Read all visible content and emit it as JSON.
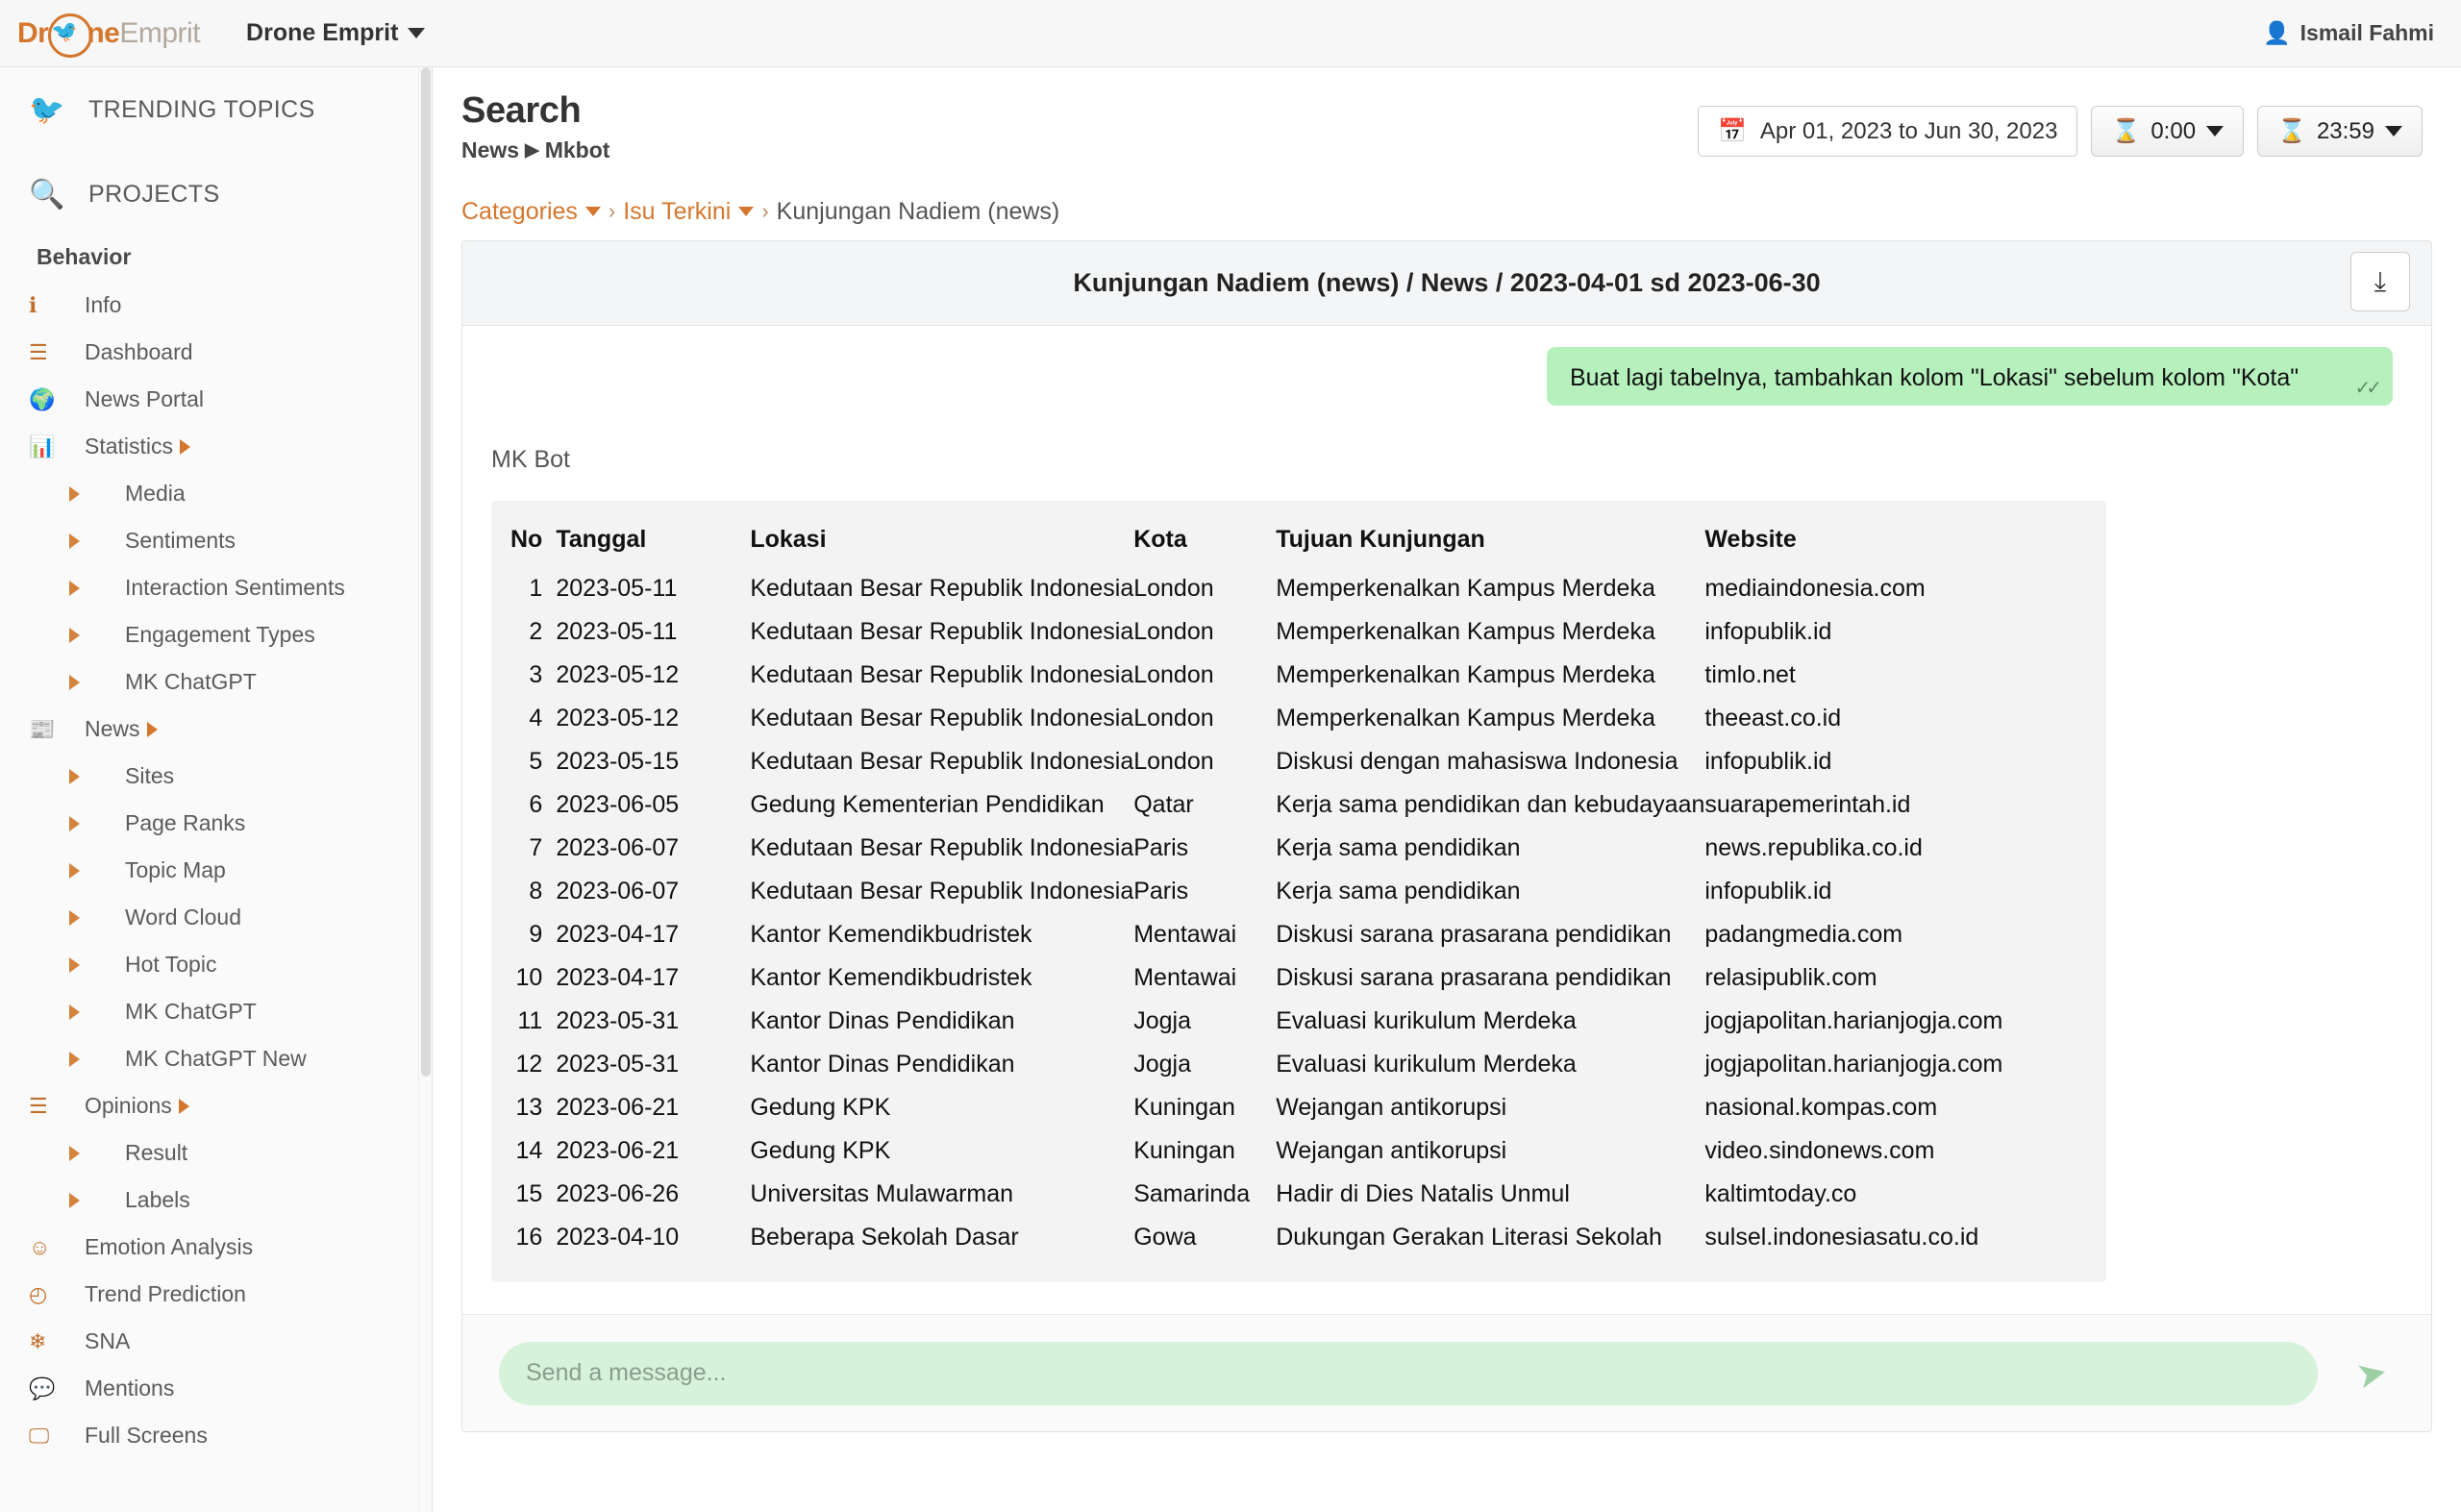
{
  "topbar": {
    "logo_dr": "Dr",
    "logo_ne": "ne",
    "logo_emprit": "Emprit",
    "bird_icon": "bird-icon",
    "app_switcher": "Drone Emprit",
    "user_name": "Ismail Fahmi",
    "user_icon": "user-icon"
  },
  "sidebar": {
    "top_items": [
      {
        "label": "TRENDING TOPICS",
        "icon": "twitter-bird-icon"
      },
      {
        "label": "PROJECTS",
        "icon": "search-icon"
      }
    ],
    "section_label": "Behavior",
    "items": [
      {
        "label": "Info",
        "icon": "info-circle-icon",
        "level": 1,
        "arrow": false
      },
      {
        "label": "Dashboard",
        "icon": "list-icon",
        "level": 1,
        "arrow": false
      },
      {
        "label": "News Portal",
        "icon": "globe-icon",
        "level": 1,
        "arrow": false
      },
      {
        "label": "Statistics",
        "icon": "bar-chart-icon",
        "level": 1,
        "arrow": true
      },
      {
        "label": "Media",
        "icon": "triangle-right-icon",
        "level": 2,
        "arrow": false
      },
      {
        "label": "Sentiments",
        "icon": "triangle-right-icon",
        "level": 2,
        "arrow": false
      },
      {
        "label": "Interaction Sentiments",
        "icon": "triangle-right-icon",
        "level": 2,
        "arrow": false
      },
      {
        "label": "Engagement Types",
        "icon": "triangle-right-icon",
        "level": 2,
        "arrow": false
      },
      {
        "label": "MK ChatGPT",
        "icon": "triangle-right-icon",
        "level": 2,
        "arrow": false
      },
      {
        "label": "News",
        "icon": "newspaper-icon",
        "level": 1,
        "arrow": true
      },
      {
        "label": "Sites",
        "icon": "triangle-right-icon",
        "level": 2,
        "arrow": false
      },
      {
        "label": "Page Ranks",
        "icon": "triangle-right-icon",
        "level": 2,
        "arrow": false
      },
      {
        "label": "Topic Map",
        "icon": "triangle-right-icon",
        "level": 2,
        "arrow": false
      },
      {
        "label": "Word Cloud",
        "icon": "triangle-right-icon",
        "level": 2,
        "arrow": false
      },
      {
        "label": "Hot Topic",
        "icon": "triangle-right-icon",
        "level": 2,
        "arrow": false
      },
      {
        "label": "MK ChatGPT",
        "icon": "triangle-right-icon",
        "level": 2,
        "arrow": false
      },
      {
        "label": "MK ChatGPT New",
        "icon": "triangle-right-icon",
        "level": 2,
        "arrow": false
      },
      {
        "label": "Opinions",
        "icon": "stack-icon",
        "level": 1,
        "arrow": true
      },
      {
        "label": "Result",
        "icon": "triangle-right-icon",
        "level": 2,
        "arrow": false
      },
      {
        "label": "Labels",
        "icon": "triangle-right-icon",
        "level": 2,
        "arrow": false
      },
      {
        "label": "Emotion Analysis",
        "icon": "smiley-icon",
        "level": 1,
        "arrow": false
      },
      {
        "label": "Trend Prediction",
        "icon": "clock-icon",
        "level": 1,
        "arrow": false
      },
      {
        "label": "SNA",
        "icon": "snowflake-icon",
        "level": 1,
        "arrow": false
      },
      {
        "label": "Mentions",
        "icon": "chat-bubble-icon",
        "level": 1,
        "arrow": false
      },
      {
        "label": "Full Screens",
        "icon": "monitor-icon",
        "level": 1,
        "arrow": false
      }
    ]
  },
  "header": {
    "title": "Search",
    "breadcrumb_parent": "News",
    "breadcrumb_child": "Mkbot",
    "date_range": "Apr 01, 2023 to Jun 30, 2023",
    "calendar_icon": "calendar-icon",
    "time_start": "0:00",
    "time_end": "23:59",
    "hourglass_icon": "hourglass-icon"
  },
  "crumbs": {
    "categories": "Categories",
    "isu_terkini": "Isu Terkini",
    "current": "Kunjungan Nadiem (news)"
  },
  "chat": {
    "panel_title": "Kunjungan Nadiem (news) / News / 2023-04-01 sd 2023-06-30",
    "download_icon": "download-icon",
    "user_message": "Buat lagi tabelnya, tambahkan kolom \"Lokasi\" sebelum kolom \"Kota\"",
    "read_ticks": "✓✓",
    "bot_name": "MK Bot",
    "input_placeholder": "Send a message...",
    "input_value": "",
    "send_icon": "send-paper-plane-icon"
  },
  "table": {
    "headers": [
      "No",
      "Tanggal",
      "Lokasi",
      "Kota",
      "Tujuan Kunjungan",
      "Website"
    ],
    "rows": [
      [
        "1",
        "2023-05-11",
        "Kedutaan Besar Republik Indonesia",
        "London",
        "Memperkenalkan Kampus Merdeka",
        "mediaindonesia.com"
      ],
      [
        "2",
        "2023-05-11",
        "Kedutaan Besar Republik Indonesia",
        "London",
        "Memperkenalkan Kampus Merdeka",
        "infopublik.id"
      ],
      [
        "3",
        "2023-05-12",
        "Kedutaan Besar Republik Indonesia",
        "London",
        "Memperkenalkan Kampus Merdeka",
        "timlo.net"
      ],
      [
        "4",
        "2023-05-12",
        "Kedutaan Besar Republik Indonesia",
        "London",
        "Memperkenalkan Kampus Merdeka",
        "theeast.co.id"
      ],
      [
        "5",
        "2023-05-15",
        "Kedutaan Besar Republik Indonesia",
        "London",
        "Diskusi dengan mahasiswa Indonesia",
        "infopublik.id"
      ],
      [
        "6",
        "2023-06-05",
        "Gedung Kementerian Pendidikan",
        "Qatar",
        "Kerja sama pendidikan dan kebudayaan",
        "suarapemerintah.id"
      ],
      [
        "7",
        "2023-06-07",
        "Kedutaan Besar Republik Indonesia",
        "Paris",
        "Kerja sama pendidikan",
        "news.republika.co.id"
      ],
      [
        "8",
        "2023-06-07",
        "Kedutaan Besar Republik Indonesia",
        "Paris",
        "Kerja sama pendidikan",
        "infopublik.id"
      ],
      [
        "9",
        "2023-04-17",
        "Kantor Kemendikbudristek",
        "Mentawai",
        "Diskusi sarana prasarana pendidikan",
        "padangmedia.com"
      ],
      [
        "10",
        "2023-04-17",
        "Kantor Kemendikbudristek",
        "Mentawai",
        "Diskusi sarana prasarana pendidikan",
        "relasipublik.com"
      ],
      [
        "11",
        "2023-05-31",
        "Kantor Dinas Pendidikan",
        "Jogja",
        "Evaluasi kurikulum Merdeka",
        "jogjapolitan.harianjogja.com"
      ],
      [
        "12",
        "2023-05-31",
        "Kantor Dinas Pendidikan",
        "Jogja",
        "Evaluasi kurikulum Merdeka",
        "jogjapolitan.harianjogja.com"
      ],
      [
        "13",
        "2023-06-21",
        "Gedung KPK",
        "Kuningan",
        "Wejangan antikorupsi",
        "nasional.kompas.com"
      ],
      [
        "14",
        "2023-06-21",
        "Gedung KPK",
        "Kuningan",
        "Wejangan antikorupsi",
        "video.sindonews.com"
      ],
      [
        "15",
        "2023-06-26",
        "Universitas Mulawarman",
        "Samarinda",
        "Hadir di Dies Natalis Unmul",
        "kaltimtoday.co"
      ],
      [
        "16",
        "2023-04-10",
        "Beberapa Sekolah Dasar",
        "Gowa",
        "Dukungan Gerakan Literasi Sekolah",
        "sulsel.indonesiasatu.co.id"
      ]
    ]
  },
  "colors": {
    "accent": "#d4772e",
    "bubble_green": "#b6f0bd",
    "input_green": "#d6f2da"
  }
}
